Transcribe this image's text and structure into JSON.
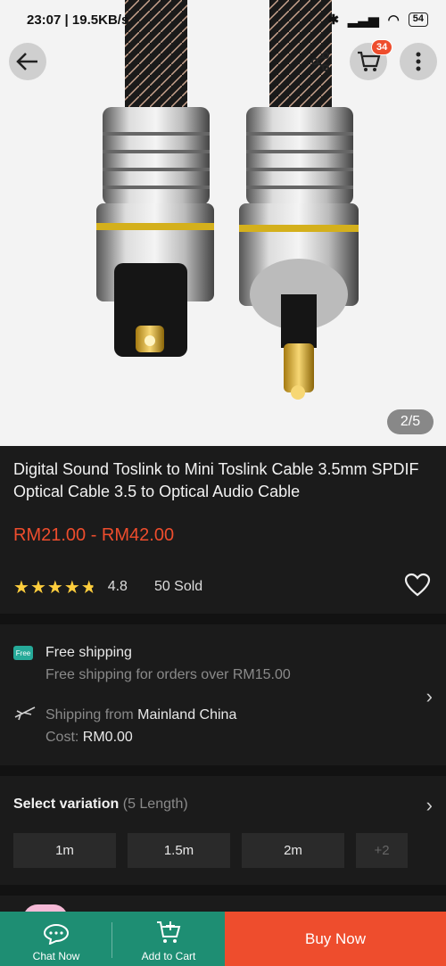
{
  "status_bar": {
    "time": "23:07",
    "speed": "19.5KB/s",
    "battery": "54"
  },
  "header": {
    "cart_count": "34",
    "image_counter": "2/5"
  },
  "product": {
    "title": "Digital Sound Toslink to Mini Toslink Cable 3.5mm SPDIF Optical Cable 3.5 to Optical Audio Cable",
    "price": "RM21.00 - RM42.00",
    "rating": "4.8",
    "rating_fraction": 0.96,
    "sold": "50 Sold"
  },
  "shipping": {
    "free_tag": "Free",
    "free_title": "Free shipping",
    "free_desc": "Free shipping for orders over RM15.00",
    "from_label": "Shipping from",
    "from_value": "Mainland China",
    "cost_label": "Cost:",
    "cost_value": "RM0.00"
  },
  "variation": {
    "title": "Select variation",
    "count": "(5 Length)",
    "options": [
      "1m",
      "1.5m",
      "2m"
    ],
    "more": "+2"
  },
  "bottom_bar": {
    "chat": "Chat Now",
    "cart": "Add to Cart",
    "buy": "Buy Now"
  },
  "colors": {
    "accent": "#ee4d2d",
    "green": "#1e8e73",
    "star": "#ffce3d",
    "free_tag": "#26aa99"
  },
  "icons": [
    "back-arrow-icon",
    "share-icon",
    "cart-icon",
    "more-vertical-icon",
    "star-icon",
    "heart-icon",
    "truck-icon",
    "plane-icon",
    "chevron-right-icon",
    "chat-icon"
  ]
}
